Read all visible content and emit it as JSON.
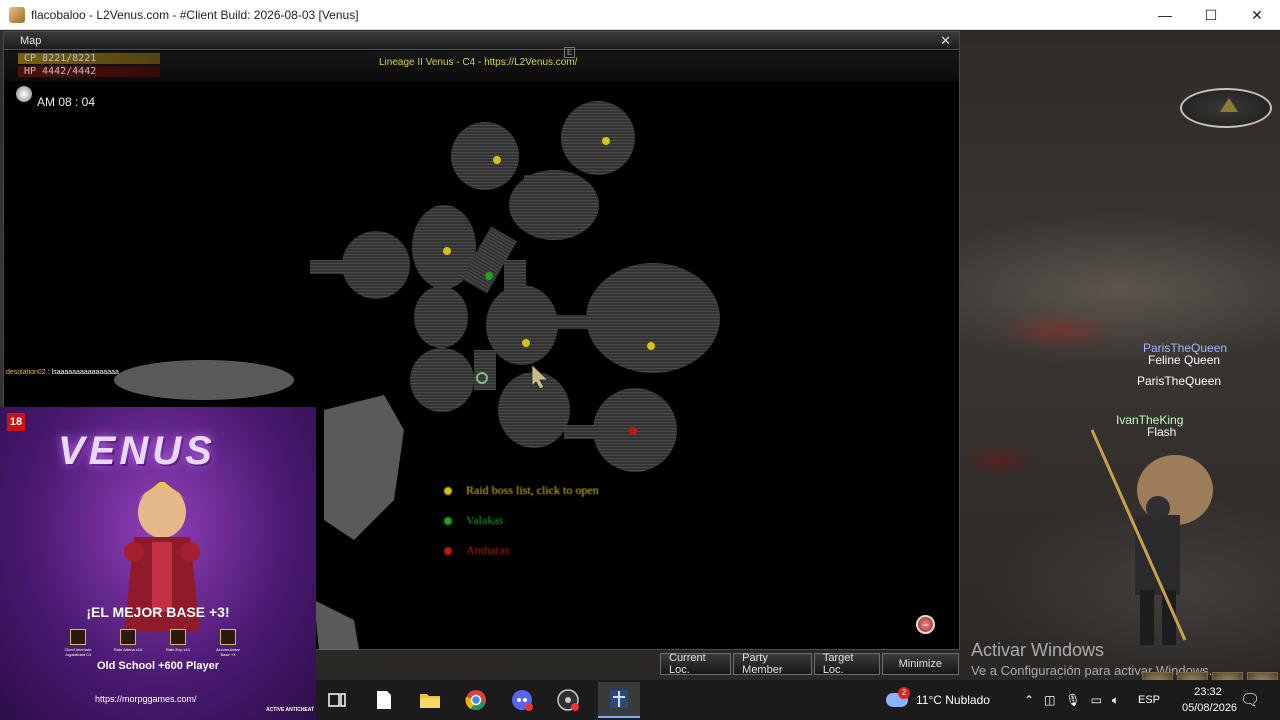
{
  "window": {
    "title": "flacobaloo - L2Venus.com - #Client Build: 2026-08-03 [Venus]",
    "minimize": "—",
    "maximize": "☐",
    "close": "✕"
  },
  "map": {
    "title": "Map",
    "close": "✕",
    "cp": "CP   8221/8221",
    "hp": "HP   4442/4442",
    "server": "Lineage II Venus - C4 - https://L2Venus.com/",
    "clock": "AM 08 : 04",
    "chat_name": "desolation02",
    "chat_text": " : lsaaaaaaaaaaaaaaaa",
    "legend": [
      {
        "label": "Raid boss list, click to open",
        "color": "#d4c214"
      },
      {
        "label": "Valakas",
        "color": "#1ea51e"
      },
      {
        "label": "Antharas",
        "color": "#c41818"
      }
    ],
    "buttons": {
      "current": "Current Loc.",
      "party": "Party Member",
      "target": "Target Loc.",
      "minimize": "Minimize"
    },
    "colors": {
      "yellow": "#d4c214",
      "green": "#1ea51e",
      "red": "#c41818",
      "room": "#3a3a3a"
    }
  },
  "players": {
    "name1": "ParisTheQueen",
    "title1": "Feline Queen",
    "name2": "ParisTheQueen",
    "name3": "IvanTheKing",
    "title3": "Flash"
  },
  "watermark": {
    "line1": "Activar Windows",
    "line2": "Ve a Configuración para activar Windows."
  },
  "ad": {
    "age": "18",
    "logo": "VENUS",
    "headline": "¡EL MEJOR BASE +3!",
    "badges": [
      "Client Interlude Jugabilidad C4",
      "Rate Adena x10",
      "Rate Exp x10",
      "Accumulative Base +3"
    ],
    "subline": "Old School +600 Player",
    "url": "https://morpggames.com/",
    "active": "ACTIVE ANTICHEAT"
  },
  "taskbar": {
    "weather_badge": "2",
    "weather": "11°C  Nublado",
    "lang": "ESP",
    "time": "23:32",
    "date": "05/08/2026"
  }
}
